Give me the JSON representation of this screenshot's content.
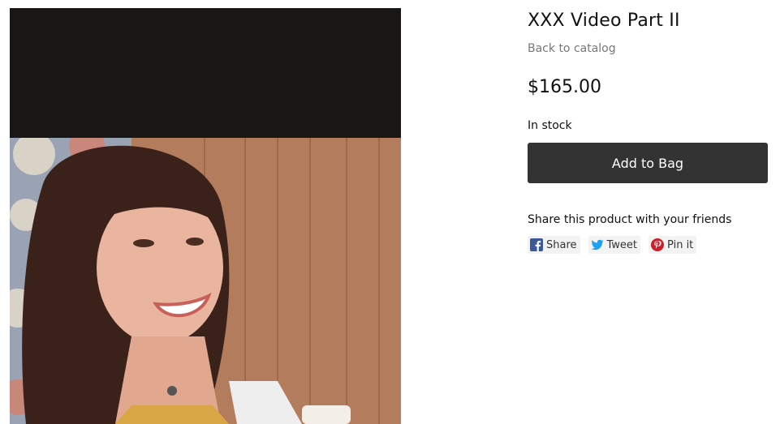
{
  "product": {
    "title": "XXX Video Part II",
    "back_link": "Back to catalog",
    "price": "$165.00",
    "stock_status": "In stock",
    "add_to_bag_label": "Add to Bag"
  },
  "share": {
    "heading": "Share this product with your friends",
    "buttons": [
      {
        "label": "Share",
        "icon": "facebook-icon",
        "color": "#3b5998"
      },
      {
        "label": "Tweet",
        "icon": "twitter-icon",
        "color": "#1da1f2"
      },
      {
        "label": "Pin it",
        "icon": "pinterest-icon",
        "color": "#cb2027"
      }
    ]
  },
  "colors": {
    "button_bg": "#333333",
    "muted_text": "#777777"
  }
}
